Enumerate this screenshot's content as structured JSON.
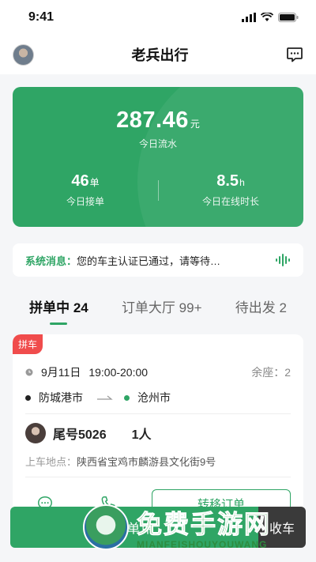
{
  "status_bar": {
    "time": "9:41"
  },
  "header": {
    "title": "老兵出行"
  },
  "stats": {
    "amount": "287.46",
    "amount_unit": "元",
    "amount_label": "今日流水",
    "orders_value": "46",
    "orders_unit": "单",
    "orders_label": "今日接单",
    "online_value": "8.5",
    "online_unit": "h",
    "online_label": "今日在线时长"
  },
  "notice": {
    "prefix": "系统消息：",
    "text": "您的车主认证已通过，请等待…"
  },
  "tabs": [
    {
      "label": "拼单中",
      "count": "24",
      "active": true
    },
    {
      "label": "订单大厅",
      "count": "99+",
      "active": false
    },
    {
      "label": "待出发",
      "count": "2",
      "active": false
    }
  ],
  "order": {
    "badge": "拼车",
    "date": "9月11日",
    "time": "19:00-20:00",
    "seats": "余座：2",
    "from": "防城港市",
    "to": "沧州市",
    "tail": "尾号5026",
    "count": "1人",
    "pickup_label": "上车地点：",
    "pickup": "陕西省宝鸡市麟游县文化街9号",
    "action": "转移订单"
  },
  "bottom": {
    "primary": "接单中",
    "secondary": "收车"
  },
  "watermark": {
    "cn": "免费手游网",
    "en": "MIANFEISHOUYOUWANG"
  },
  "colors": {
    "brand_green": "#2fa565",
    "badge_red": "#f04c4c"
  }
}
